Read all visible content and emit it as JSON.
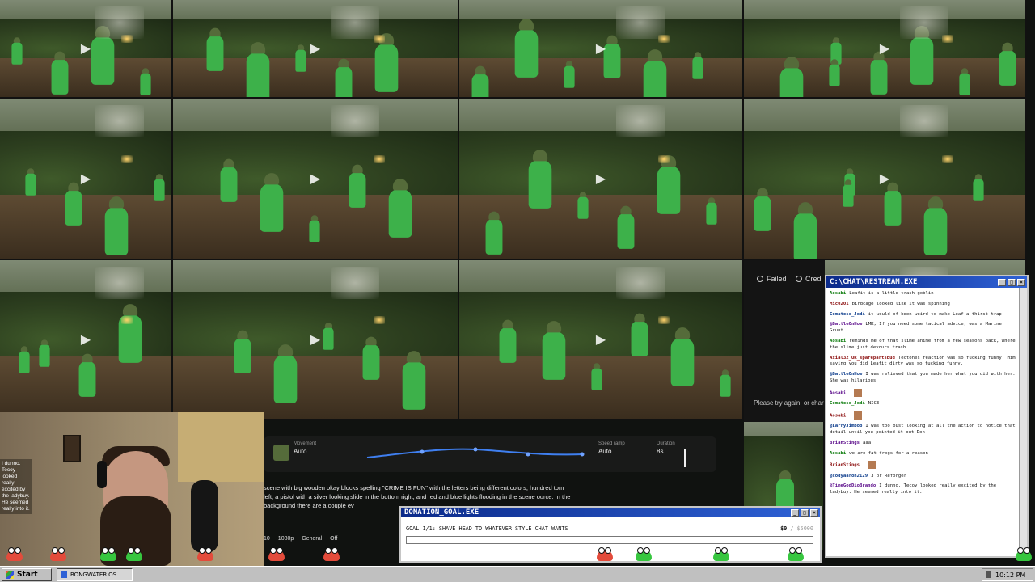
{
  "sora": {
    "status_failed": "Failed",
    "status_credits": "Credi",
    "error_message": "Please try again, or char"
  },
  "settings": {
    "movement_label": "Movement",
    "movement_value": "Auto",
    "speed_label": "Speed ramp",
    "speed_value": "Auto",
    "duration_label": "Duration",
    "duration_value": "8s"
  },
  "prompt": {
    "text": "scene with big wooden okay blocks spelling \"CRIME IS FUN\" with the letters being different colors, hundred tom left, a pistol with a silver looking slide in the bottom right, and red and blue lights flooding in the scene ource. In the background there are a couple ev",
    "resolution": "1080p",
    "style": "General",
    "toggle": "Off",
    "prefix": "10"
  },
  "webcam": {
    "caption": "I dunno. Tecoy looked really excited by the ladybuy. He seemed really into it."
  },
  "chat": {
    "title": "C:\\CHAT\\RESTREAM.EXE",
    "messages": [
      {
        "user": "Aosabi",
        "text": "Leafit is a little trash goblin"
      },
      {
        "user": "Mic0201",
        "text": "birdcage looked like it was spinning"
      },
      {
        "user": "Comatose_Jedi",
        "text": "it would of been weird to make Leaf a thirst trap"
      },
      {
        "user": "@BattleOnHoe",
        "text": "LMK, If you need some tacical advice, was a Marine Grunt"
      },
      {
        "user": "Aosabi",
        "text": "reminds me of that slime anime from a few seasons back, where the slime just devours trash"
      },
      {
        "user": "Axial32_UR_sparepartsbud",
        "text": "Tectones reaction was so fucking funny. Him saying you did Leafit dirty was so fucking funny."
      },
      {
        "user": "@BattleOnHoe",
        "text": "I was relieved that you made her what you did with her. She was hilarious"
      },
      {
        "user": "Aosabi",
        "text": ""
      },
      {
        "user": "Comatose_Jedi",
        "text": "NICE"
      },
      {
        "user": "Aosabi",
        "text": ""
      },
      {
        "user": "@LarryJimbob",
        "text": "I was too bust looking at all the action to notice that detail until you pointed it out Don"
      },
      {
        "user": "BrianStings",
        "text": "aaa"
      },
      {
        "user": "Aosabi",
        "text": "we are fat frogs for a reason"
      },
      {
        "user": "BrianStings",
        "text": ""
      },
      {
        "user": "@codyaaron2129",
        "text": "3 or Reforger"
      },
      {
        "user": "@TimeGodDioBrando",
        "text": "I dunno. Tecoy looked really excited by the ladybuy. He seemed really into it."
      }
    ]
  },
  "donation": {
    "title": "DONATION_GOAL.EXE",
    "goal_text": "GOAL 1/1: SHAVE HEAD TO WHATEVER STYLE CHAT WANTS",
    "amount_current": "$0",
    "amount_max": "/ $5000",
    "progress": 0
  },
  "taskbar": {
    "start_label": "Start",
    "app_label": "BONGWATER.OS",
    "clock": "10:12 PM"
  },
  "colors": {
    "title_bar": "#0b2a8a",
    "frog_green": "#37c63f",
    "frog_red": "#e34b3b"
  }
}
